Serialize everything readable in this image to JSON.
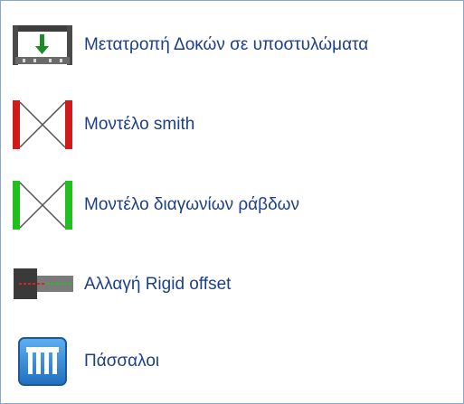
{
  "menu": {
    "items": [
      {
        "label": "Μετατροπή Δοκών σε υποστυλώματα",
        "icon": "beam-to-column-icon"
      },
      {
        "label": "Μοντέλο smith",
        "icon": "smith-model-icon"
      },
      {
        "label": "Μοντέλο διαγωνίων ράβδων",
        "icon": "diagonal-bars-model-icon"
      },
      {
        "label": "Αλλαγή Rigid offset",
        "icon": "rigid-offset-icon"
      },
      {
        "label": "Πάσσαλοι",
        "icon": "piles-icon"
      }
    ]
  },
  "colors": {
    "label_text": "#1c3f8a",
    "panel_border": "#8aa6c8",
    "smith_red": "#d11a1a",
    "diagonal_green": "#22c01e",
    "arrow_green": "#1e8a2a",
    "pile_blue": "#2a7fd0"
  }
}
